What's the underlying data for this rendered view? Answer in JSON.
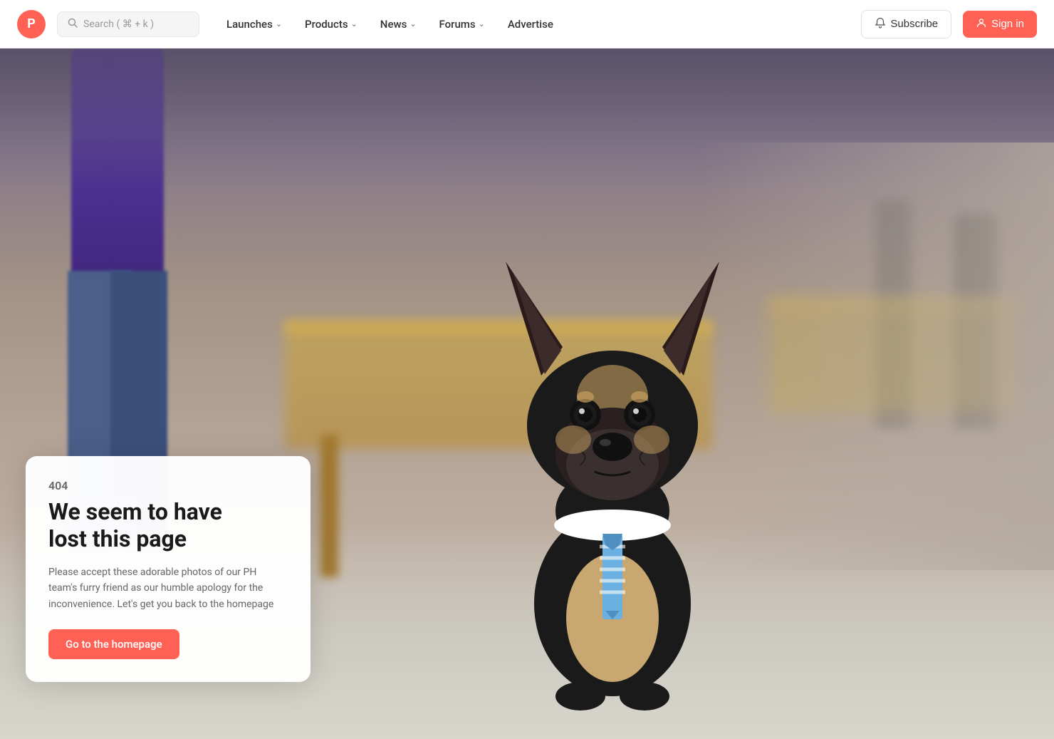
{
  "navbar": {
    "logo_letter": "P",
    "logo_color": "#ff6154",
    "search_placeholder": "Search ( ⌘ + k )",
    "nav_items": [
      {
        "id": "launches",
        "label": "Launches",
        "has_dropdown": true
      },
      {
        "id": "products",
        "label": "Products",
        "has_dropdown": true
      },
      {
        "id": "news",
        "label": "News",
        "has_dropdown": true
      },
      {
        "id": "forums",
        "label": "Forums",
        "has_dropdown": true
      },
      {
        "id": "advertise",
        "label": "Advertise",
        "has_dropdown": false
      }
    ],
    "subscribe_label": "Subscribe",
    "signin_label": "Sign in"
  },
  "error_page": {
    "error_code": "404",
    "title_line1": "We seem to have",
    "title_line2": "lost this page",
    "description": "Please accept these adorable photos of our PH team's furry friend as our humble apology for the inconvenience. Let's get you back to the homepage",
    "cta_label": "Go to the homepage"
  },
  "icons": {
    "search": "🔍",
    "chevron_down": "⌄",
    "bell": "🔔",
    "user": "👤"
  }
}
